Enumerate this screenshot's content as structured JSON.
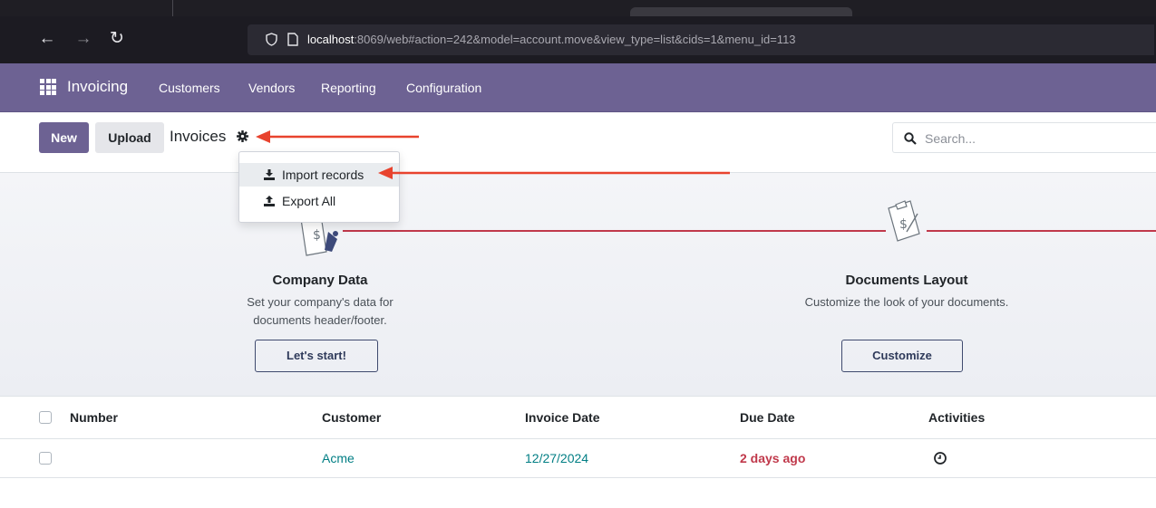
{
  "browser": {
    "back_icon": "arrow-left-icon",
    "forward_icon": "arrow-right-icon",
    "reload_icon": "reload-icon",
    "url_host": "localhost",
    "url_rest": ":8069/web#action=242&model=account.move&view_type=list&cids=1&menu_id=113"
  },
  "app_nav": {
    "brand": "Invoicing",
    "menus": [
      "Customers",
      "Vendors",
      "Reporting",
      "Configuration"
    ],
    "bg_color": "#6d6293"
  },
  "control_panel": {
    "new_label": "New",
    "upload_label": "Upload",
    "title": "Invoices",
    "search_placeholder": "Search..."
  },
  "actions_menu": {
    "items": [
      {
        "label": "Import records",
        "icon": "download-icon",
        "highlighted": true
      },
      {
        "label": "Export All",
        "icon": "upload-icon",
        "highlighted": false
      }
    ]
  },
  "onboarding": {
    "steps": [
      {
        "title": "Company Data",
        "description_line1": "Set your company's data for",
        "description_line2": "documents header/footer.",
        "button": "Let's start!",
        "icon": "invoice-pen-icon"
      },
      {
        "title": "Documents Layout",
        "description_line1": "Customize the look of your documents.",
        "description_line2": "",
        "button": "Customize",
        "icon": "clipboard-dollar-icon"
      }
    ],
    "accent_color": "#c0394b"
  },
  "table": {
    "headers": [
      "Number",
      "Customer",
      "Invoice Date",
      "Due Date",
      "Activities"
    ],
    "rows": [
      {
        "number": "",
        "customer": "Acme",
        "invoice_date": "12/27/2024",
        "due_date": "2 days ago",
        "activity_icon": "clock-icon"
      }
    ],
    "link_color": "#017e84",
    "overdue_color": "#c0394b"
  },
  "annotations": {
    "arrow_color": "#e8432e"
  }
}
